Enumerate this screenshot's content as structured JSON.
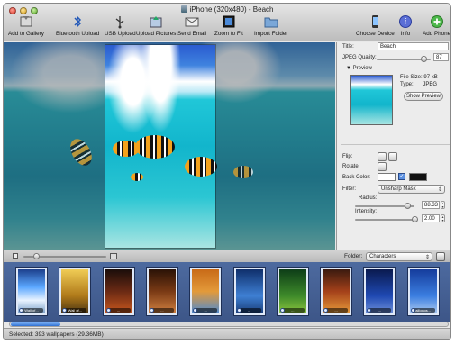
{
  "window": {
    "title": "iPhone (320x480) - Beach"
  },
  "toolbar": {
    "items": [
      {
        "label": "Add to Gallery"
      },
      {
        "label": "Bluetooth Upload"
      },
      {
        "label": "USB Upload"
      },
      {
        "label": "Upload Pictures"
      },
      {
        "label": "Send Email"
      },
      {
        "label": "Zoom to Fit"
      },
      {
        "label": "Import Folder"
      },
      {
        "label": "Choose Device"
      },
      {
        "label": "Info"
      },
      {
        "label": "Add Phone"
      }
    ]
  },
  "inspector": {
    "title_label": "Title:",
    "title_value": "Beach",
    "jpeg_label": "JPEG Quality:",
    "jpeg_value": "87",
    "jpeg_quality": 0.87,
    "preview_label": "Preview",
    "file_size_label": "File Size:",
    "file_size_value": "97 kB",
    "type_label": "Type:",
    "type_value": "JPEG",
    "preview_button": "Show Preview",
    "flip_label": "Flip:",
    "rotate_label": "Rotate:",
    "back_color_label": "Back Color:",
    "filter_label": "Filter:",
    "filter_value": "Unsharp Mask",
    "radius_label": "Radius:",
    "radius_value": "88.33",
    "radius_level": 0.88,
    "intensity_label": "Intensity:",
    "intensity_value": "2.00",
    "intensity_level": 1.0
  },
  "browser": {
    "folder_label": "Folder:",
    "folder_value": "Characters",
    "thumbnails": [
      {
        "label": "Wall of..."
      },
      {
        "label": "Wall of..."
      },
      {
        "label": "..."
      },
      {
        "label": "..."
      },
      {
        "label": "..."
      },
      {
        "label": "..."
      },
      {
        "label": "..."
      },
      {
        "label": "..."
      },
      {
        "label": "..."
      },
      {
        "label": "ailionos..."
      }
    ]
  },
  "status": {
    "text": "Selected: 393 wallpapers (29.36MB)"
  },
  "colors": {
    "accent": "#2f6fd2",
    "gallery_bg": "#4d6a9f"
  }
}
